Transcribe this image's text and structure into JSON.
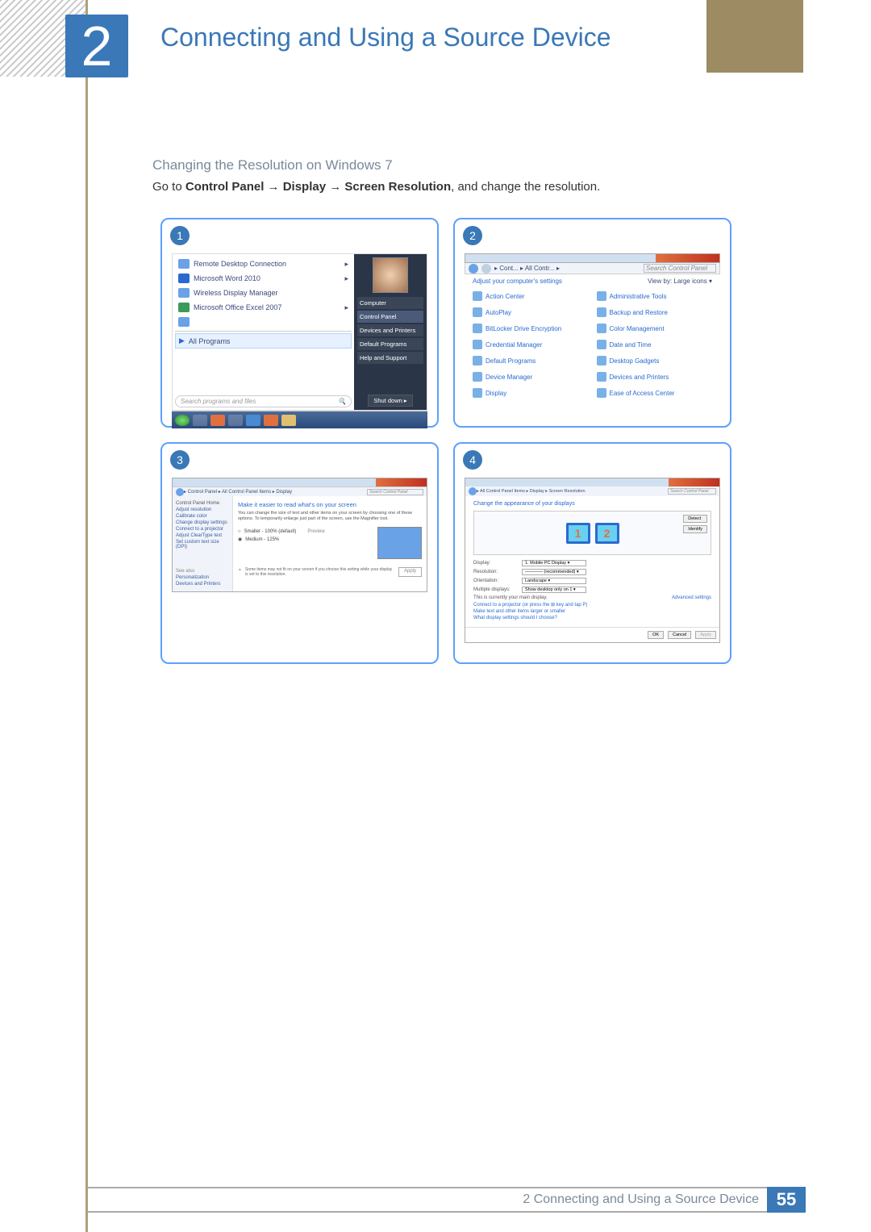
{
  "chapter": {
    "num": "2",
    "title": "Connecting and Using a Source Device"
  },
  "section": "Changing the Resolution on Windows 7",
  "instruction": {
    "pre": "Go to ",
    "b1": "Control Panel",
    "arrow": " → ",
    "b2": "Display",
    "b3": "Screen Resolution",
    "post": ", and change the resolution."
  },
  "panel1": {
    "badge": "1",
    "items": [
      "Remote Desktop Connection",
      "Microsoft Word 2010",
      "Wireless Display Manager",
      "Microsoft Office Excel 2007"
    ],
    "all_programs": "All Programs",
    "search_placeholder": "Search programs and files",
    "right_links": [
      "Computer",
      "Control Panel",
      "Devices and Printers",
      "Default Programs",
      "Help and Support"
    ],
    "shutdown": "Shut down"
  },
  "panel2": {
    "badge": "2",
    "breadcrumb": "▸ Cont... ▸ All Contr... ▸",
    "search_placeholder": "Search Control Panel",
    "header": "Adjust your computer's settings",
    "viewby": "View by:   Large icons ▾",
    "entries_left": [
      "Action Center",
      "AutoPlay",
      "BitLocker Drive Encryption",
      "Credential Manager",
      "Default Programs",
      "Device Manager",
      "Display"
    ],
    "entries_right": [
      "Administrative Tools",
      "Backup and Restore",
      "Color Management",
      "Date and Time",
      "Desktop Gadgets",
      "Devices and Printers",
      "Ease of Access Center"
    ]
  },
  "panel3": {
    "badge": "3",
    "breadcrumb": "▸ Control Panel ▸ All Control Panel Items ▸ Display",
    "search_placeholder": "Search Control Panel",
    "side_header": "Control Panel Home",
    "side_links": [
      "Adjust resolution",
      "Calibrate color",
      "Change display settings",
      "Connect to a projector",
      "Adjust ClearType text",
      "Set custom text size (DPI)"
    ],
    "side_see": "See also",
    "side_see_links": [
      "Personalization",
      "Devices and Printers"
    ],
    "main_h": "Make it easier to read what's on your screen",
    "main_p": "You can change the size of text and other items on your screen by choosing one of these options. To temporarily enlarge just part of the screen, use the Magnifier tool.",
    "radio1": "Smaller - 100% (default)",
    "preview_label": "Preview",
    "radio2": "Medium - 125%",
    "warning": "Some items may not fit on your screen if you choose this setting while your display is set to this resolution.",
    "apply": "Apply"
  },
  "panel4": {
    "badge": "4",
    "breadcrumb": "▸ All Control Panel Items ▸ Display ▸ Screen Resolution",
    "search_placeholder": "Search Control Panel",
    "main_h": "Change the appearance of your displays",
    "mon1": "1",
    "mon2": "2",
    "detect": "Detect",
    "identify": "Identify",
    "f_display": "Display:",
    "v_display": "1. Mobile PC Display ▾",
    "f_res": "Resolution:",
    "v_res": "———— (recommended) ▾",
    "f_orient": "Orientation:",
    "v_orient": "Landscape           ▾",
    "f_multi": "Multiple displays:",
    "v_multi": "Show desktop only on 1 ▾",
    "main_note": "This is currently your main display.",
    "advanced": "Advanced settings",
    "link1": "Connect to a projector (or press the ⊞ key and tap P)",
    "link2": "Make text and other items larger or smaller",
    "link3": "What display settings should I choose?",
    "ok": "OK",
    "cancel": "Cancel",
    "apply": "Apply"
  },
  "footer": {
    "label": "2 Connecting and Using a Source Device",
    "page": "55"
  }
}
